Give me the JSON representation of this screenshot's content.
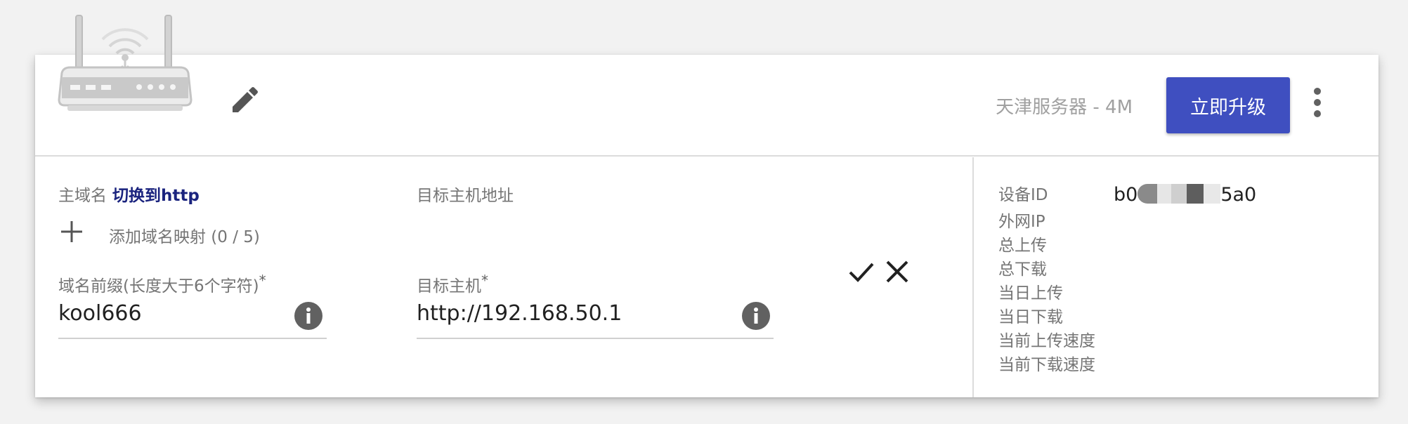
{
  "header": {
    "server_label": "天津服务器 - 4M",
    "upgrade_label": "立即升级",
    "router_icon": "router-icon",
    "edit_icon": "pencil-icon",
    "more_icon": "more-vert-icon"
  },
  "mapping": {
    "main_domain_label": "主域名",
    "switch_link": "切换到http",
    "target_address_label": "目标主机地址",
    "add_label": "添加域名映射 (0 / 5)",
    "prefix_label": "域名前缀(长度大于6个字符)",
    "prefix_value": "kool666",
    "target_host_label": "目标主机",
    "target_host_value": "http://192.168.50.1",
    "required_mark": "*"
  },
  "device": {
    "id_label": "设备ID",
    "id_value_start": "b0",
    "id_value_end": "5a0",
    "rows": [
      "外网IP",
      "总上传",
      "总下载",
      "当日上传",
      "当日下载",
      "当前上传速度",
      "当前下载速度"
    ]
  },
  "colors": {
    "accent": "#3f4fc0",
    "link": "#1a237e",
    "icon_gray": "#757575"
  }
}
